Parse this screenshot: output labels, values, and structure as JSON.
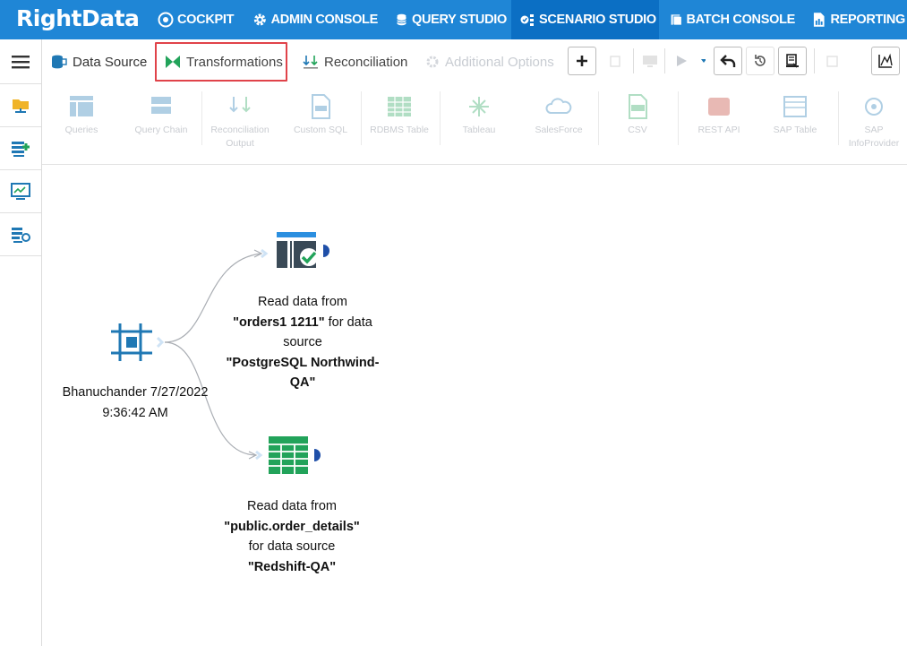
{
  "app": {
    "logo_text": "RightData"
  },
  "nav": [
    {
      "label": "COCKPIT",
      "icon": "cockpit-icon"
    },
    {
      "label": "ADMIN CONSOLE",
      "icon": "gear-icon"
    },
    {
      "label": "QUERY STUDIO",
      "icon": "database-icon"
    },
    {
      "label": "SCENARIO STUDIO",
      "icon": "scenario-icon",
      "active": true
    },
    {
      "label": "BATCH CONSOLE",
      "icon": "batch-icon"
    },
    {
      "label": "REPORTING",
      "icon": "report-icon"
    }
  ],
  "tabs": [
    {
      "label": "Data Source",
      "icon": "data-source-icon"
    },
    {
      "label": "Transformations",
      "icon": "transformations-icon",
      "highlighted": true
    },
    {
      "label": "Reconciliation",
      "icon": "reconciliation-icon"
    },
    {
      "label": "Additional Options",
      "icon": "gear-icon",
      "disabled": true
    }
  ],
  "sources": [
    {
      "label": "Queries"
    },
    {
      "label": "Query Chain"
    },
    {
      "label": "Reconciliation Output"
    },
    {
      "label": "Custom SQL"
    },
    {
      "label": "RDBMS Table"
    },
    {
      "label": "Tableau"
    },
    {
      "label": "SalesForce"
    },
    {
      "label": "CSV"
    },
    {
      "label": "REST API"
    },
    {
      "label": "SAP Table"
    },
    {
      "label": "SAP InfoProvider"
    }
  ],
  "nodes": {
    "root": {
      "line1": "Bhanuchander 7/27/2022",
      "line2": "9:36:42 AM"
    },
    "top": {
      "prefix": "Read data from",
      "table": "\"orders1 1211\"",
      "mid": " for data source ",
      "source": "\"PostgreSQL Northwind-QA\""
    },
    "bottom": {
      "prefix": "Read data from",
      "table": "\"public.order_details\"",
      "mid": "for data source",
      "source": "\"Redshift-QA\""
    }
  },
  "colors": {
    "topbar": "#1f86d6",
    "active_nav": "#0b6fc4",
    "highlight_border": "#e0434a",
    "node_blue": "#1f78b4",
    "node_green": "#22a35a"
  }
}
